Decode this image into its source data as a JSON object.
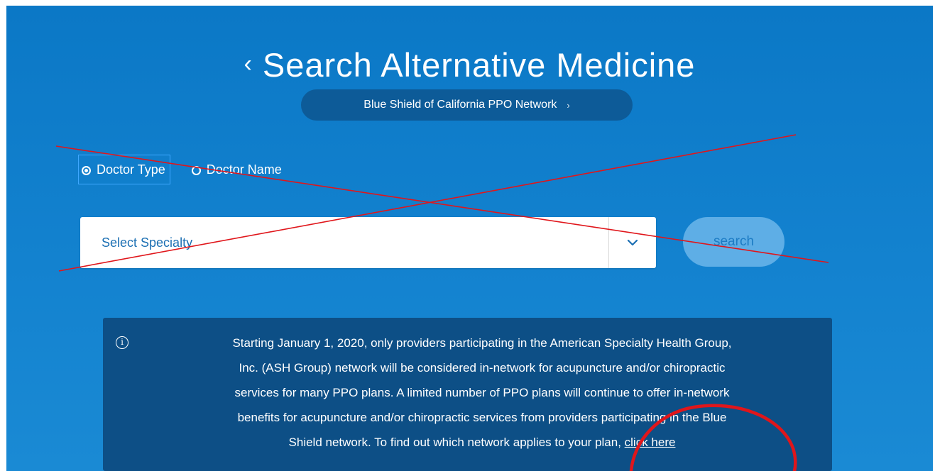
{
  "header": {
    "back_glyph": "‹",
    "title": "Search Alternative Medicine",
    "network_label": "Blue Shield of California PPO Network",
    "network_chevron": "›"
  },
  "search_mode": {
    "options": [
      {
        "label": "Doctor Type",
        "selected": true
      },
      {
        "label": "Doctor Name",
        "selected": false
      }
    ]
  },
  "specialty_select": {
    "placeholder": "Select Specialty"
  },
  "search_button": {
    "label": "search"
  },
  "notice": {
    "icon": "info-icon",
    "lines": [
      "Starting January 1, 2020, only providers participating in the American Specialty Health Group,",
      "Inc. (ASH Group) network will be considered in-network for acupuncture and/or chiropractic",
      "services for many PPO plans. A limited number of PPO plans will continue to offer in-network",
      "benefits for acupuncture and/or chiropractic services from providers participating in the Blue"
    ],
    "last_line_prefix": "Shield network. To find out which network applies to your plan, ",
    "link_text": "click here"
  },
  "colors": {
    "panel": "#0b78c6",
    "pill": "#0d5b98",
    "notice_bg": "#0d4f86",
    "annotation": "#e0161b"
  }
}
